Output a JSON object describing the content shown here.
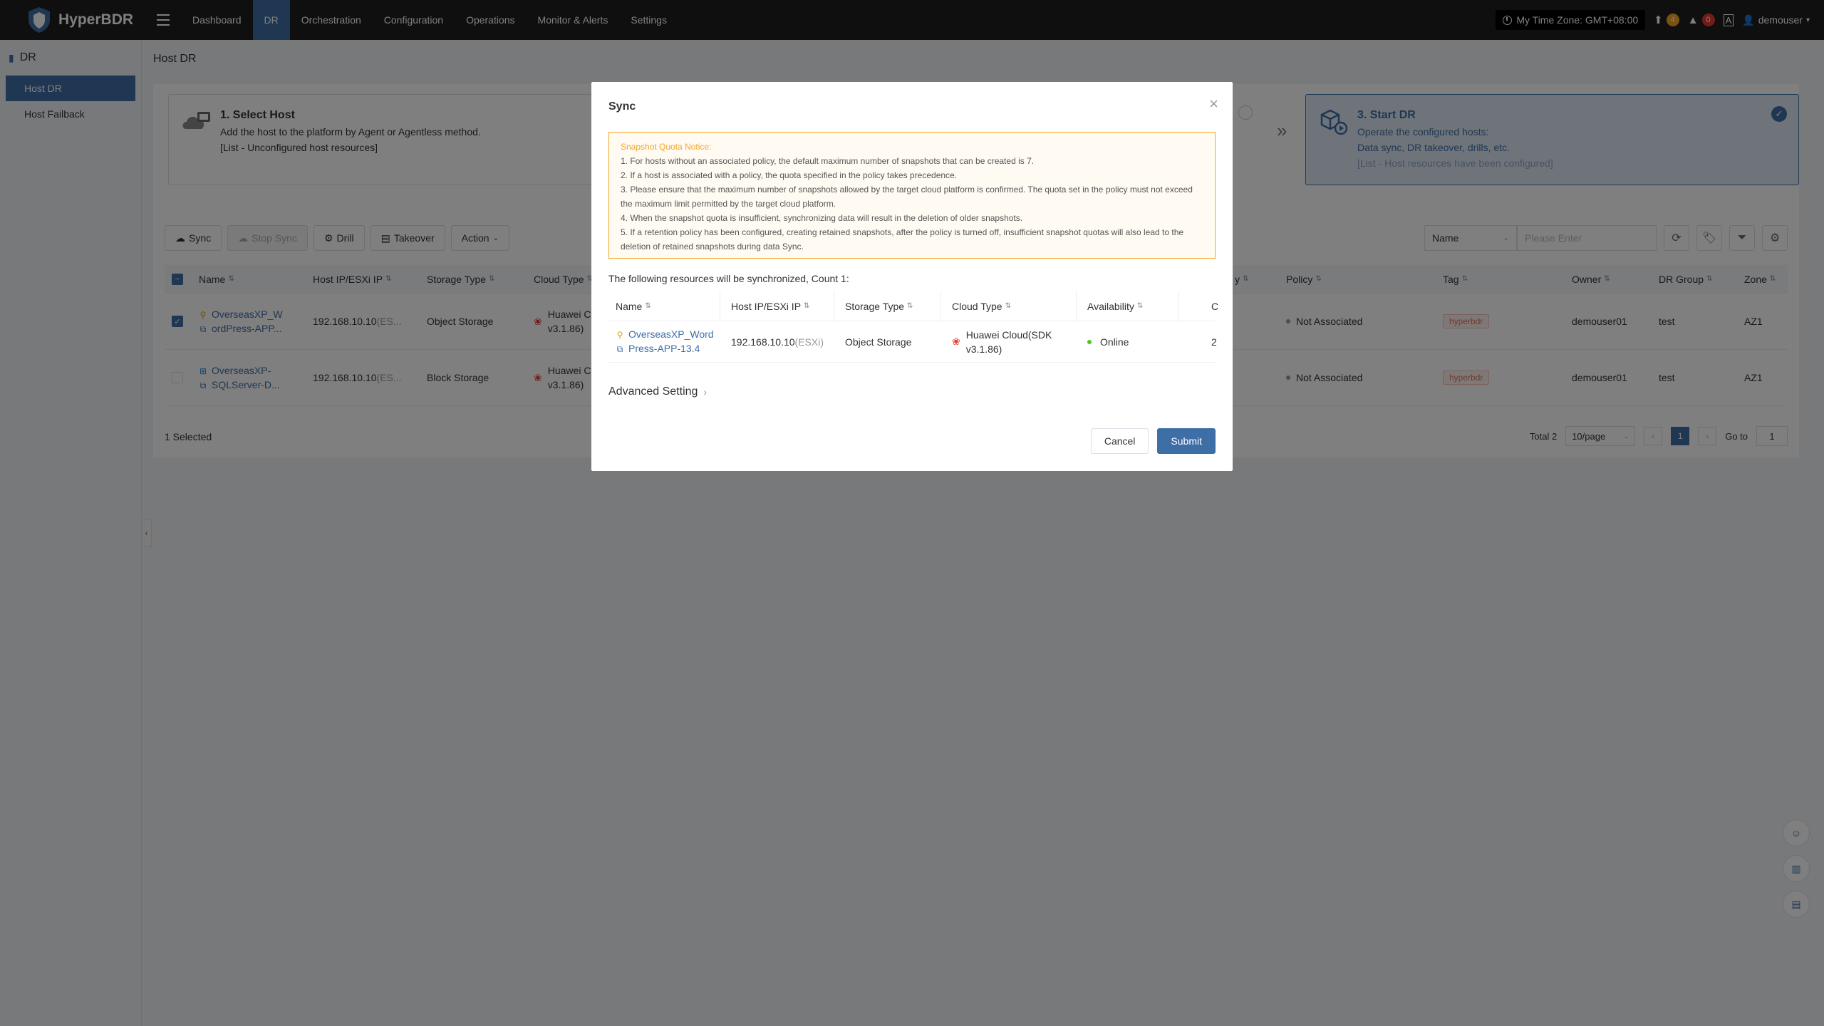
{
  "app": {
    "name": "HyperBDR"
  },
  "nav": [
    {
      "label": "Dashboard",
      "active": false
    },
    {
      "label": "DR",
      "active": true
    },
    {
      "label": "Orchestration",
      "active": false
    },
    {
      "label": "Configuration",
      "active": false
    },
    {
      "label": "Operations",
      "active": false
    },
    {
      "label": "Monitor & Alerts",
      "active": false
    },
    {
      "label": "Settings",
      "active": false
    }
  ],
  "topright": {
    "timezone": "My Time Zone: GMT+08:00",
    "upgrade_count": "4",
    "alert_count": "0",
    "user": "demouser"
  },
  "sidebar": {
    "title": "DR",
    "items": [
      {
        "label": "Host DR",
        "active": true
      },
      {
        "label": "Host Failback",
        "active": false
      }
    ]
  },
  "page": {
    "title": "Host DR"
  },
  "steps": {
    "step1": {
      "title": "1. Select Host",
      "line1": "Add the host to the platform by Agent or Agentless method.",
      "line2": "[List - Unconfigured host resources]"
    },
    "step3": {
      "title": "3. Start DR",
      "line1": "Operate the configured hosts:",
      "line2": "Data sync, DR takeover, drills, etc.",
      "line3": "[List - Host resources have been configured]"
    }
  },
  "toolbar": {
    "sync": "Sync",
    "stop_sync": "Stop Sync",
    "drill": "Drill",
    "takeover": "Takeover",
    "action": "Action"
  },
  "filter": {
    "field": "Name",
    "placeholder": "Please Enter"
  },
  "table": {
    "headers": {
      "name": "Name",
      "ip": "Host IP/ESXi IP",
      "storage": "Storage Type",
      "cloud": "Cloud Type",
      "hidden_y": "y",
      "policy": "Policy",
      "tag": "Tag",
      "owner": "Owner",
      "group": "DR Group",
      "zone": "Zone"
    },
    "rows": [
      {
        "selected": true,
        "os": "linux",
        "name1": "OverseasXP_W",
        "name2": "ordPress-APP...",
        "ip": "192.168.10.10",
        "ip_suffix": "(ES...",
        "storage": "Object Storage",
        "cloud1": "Huawei C",
        "cloud2": "v3.1.86)",
        "policy": "Not Associated",
        "tag": "hyperbdr",
        "owner": "demouser01",
        "group": "test",
        "zone": "AZ1"
      },
      {
        "selected": false,
        "os": "windows",
        "name1": "OverseasXP-",
        "name2": "SQLServer-D...",
        "ip": "192.168.10.10",
        "ip_suffix": "(ES...",
        "storage": "Block Storage",
        "cloud1": "Huawei C",
        "cloud2": "v3.1.86)",
        "policy": "Not Associated",
        "tag": "hyperbdr",
        "owner": "demouser01",
        "group": "test",
        "zone": "AZ1"
      }
    ]
  },
  "footer": {
    "selected": "1 Selected",
    "total": "Total 2",
    "page_size": "10/page",
    "current_page": "1",
    "goto_label": "Go to",
    "goto_value": "1"
  },
  "dialog": {
    "title": "Sync",
    "notice_title": "Snapshot Quota Notice:",
    "notice_lines": [
      "1. For hosts without an associated policy, the default maximum number of snapshots that can be created is 7.",
      "2. If a host is associated with a policy, the quota specified in the policy takes precedence.",
      "3. Please ensure that the maximum number of snapshots allowed by the target cloud platform is confirmed. The quota set in the policy must not exceed the maximum limit permitted by the target cloud platform.",
      "4. When the snapshot quota is insufficient, synchronizing data will result in the deletion of older snapshots.",
      "5. If a retention policy has been configured, creating retained snapshots, after the policy is turned off, insufficient snapshot quotas will also lead to the deletion of retained snapshots during data Sync."
    ],
    "count_text": "The following resources will be synchronized, Count 1:",
    "headers": {
      "name": "Name",
      "ip": "Host IP/ESXi IP",
      "storage": "Storage Type",
      "cloud": "Cloud Type",
      "availability": "Availability",
      "more": "C"
    },
    "row": {
      "name1": "OverseasXP_Word",
      "name2": "Press-APP-13.4",
      "ip": "192.168.10.10",
      "ip_suffix": "(ESXi)",
      "storage": "Object Storage",
      "cloud1": "Huawei Cloud(SDK",
      "cloud2": "v3.1.86)",
      "availability": "Online",
      "more": "2"
    },
    "advanced": "Advanced Setting",
    "cancel": "Cancel",
    "submit": "Submit"
  },
  "colors": {
    "primary": "#3e6ea6",
    "topbar": "#1f1f1f",
    "warning": "#f5a623",
    "danger": "#e53935",
    "online": "#52c41a"
  }
}
